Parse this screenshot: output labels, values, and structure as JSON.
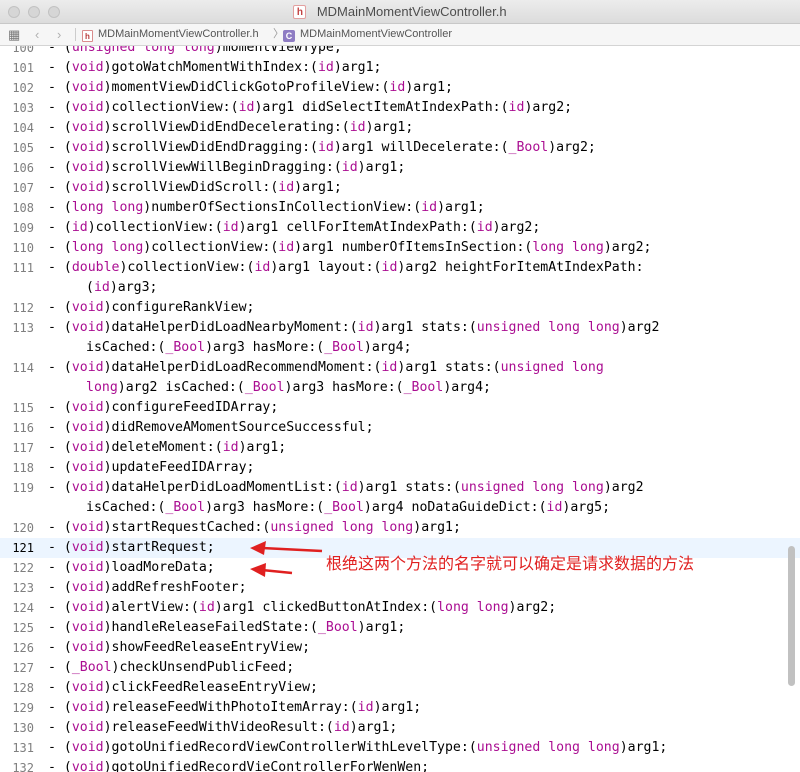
{
  "window": {
    "title": "MDMainMomentViewController.h",
    "title_icon_letter": "h"
  },
  "jumpbar": {
    "grid_icon": "grid-icon",
    "back_glyph": "‹",
    "forward_glyph": "›",
    "crumb1_icon": "h",
    "crumb1": "MDMainMomentViewController.h",
    "crumb_sep": "〉",
    "crumb2_icon": "C",
    "crumb2": "MDMainMomentViewController"
  },
  "colors": {
    "keyword": "#aa0d91",
    "annotation": "#e02020",
    "current_line": "#ecf5ff"
  },
  "current_line": "121",
  "code_lines": [
    {
      "n": "100",
      "segs": [
        [
          "- (",
          ""
        ],
        [
          "unsigned long long",
          "kw"
        ],
        [
          ")momentViewType;",
          ""
        ]
      ]
    },
    {
      "n": "101",
      "segs": [
        [
          "- (",
          ""
        ],
        [
          "void",
          "kw"
        ],
        [
          ")gotoWatchMomentWithIndex:(",
          ""
        ],
        [
          "id",
          "kw"
        ],
        [
          ")arg1;",
          ""
        ]
      ]
    },
    {
      "n": "102",
      "segs": [
        [
          "- (",
          ""
        ],
        [
          "void",
          "kw"
        ],
        [
          ")momentViewDidClickGotoProfileView:(",
          ""
        ],
        [
          "id",
          "kw"
        ],
        [
          ")arg1;",
          ""
        ]
      ]
    },
    {
      "n": "103",
      "segs": [
        [
          "- (",
          ""
        ],
        [
          "void",
          "kw"
        ],
        [
          ")collectionView:(",
          ""
        ],
        [
          "id",
          "kw"
        ],
        [
          ")arg1 didSelectItemAtIndexPath:(",
          ""
        ],
        [
          "id",
          "kw"
        ],
        [
          ")arg2;",
          ""
        ]
      ]
    },
    {
      "n": "104",
      "segs": [
        [
          "- (",
          ""
        ],
        [
          "void",
          "kw"
        ],
        [
          ")scrollViewDidEndDecelerating:(",
          ""
        ],
        [
          "id",
          "kw"
        ],
        [
          ")arg1;",
          ""
        ]
      ]
    },
    {
      "n": "105",
      "segs": [
        [
          "- (",
          ""
        ],
        [
          "void",
          "kw"
        ],
        [
          ")scrollViewDidEndDragging:(",
          ""
        ],
        [
          "id",
          "kw"
        ],
        [
          ")arg1 willDecelerate:(",
          ""
        ],
        [
          "_Bool",
          "kw"
        ],
        [
          ")arg2;",
          ""
        ]
      ]
    },
    {
      "n": "106",
      "segs": [
        [
          "- (",
          ""
        ],
        [
          "void",
          "kw"
        ],
        [
          ")scrollViewWillBeginDragging:(",
          ""
        ],
        [
          "id",
          "kw"
        ],
        [
          ")arg1;",
          ""
        ]
      ]
    },
    {
      "n": "107",
      "segs": [
        [
          "- (",
          ""
        ],
        [
          "void",
          "kw"
        ],
        [
          ")scrollViewDidScroll:(",
          ""
        ],
        [
          "id",
          "kw"
        ],
        [
          ")arg1;",
          ""
        ]
      ]
    },
    {
      "n": "108",
      "segs": [
        [
          "- (",
          ""
        ],
        [
          "long long",
          "kw"
        ],
        [
          ")numberOfSectionsInCollectionView:(",
          ""
        ],
        [
          "id",
          "kw"
        ],
        [
          ")arg1;",
          ""
        ]
      ]
    },
    {
      "n": "109",
      "segs": [
        [
          "- (",
          ""
        ],
        [
          "id",
          "kw"
        ],
        [
          ")collectionView:(",
          ""
        ],
        [
          "id",
          "kw"
        ],
        [
          ")arg1 cellForItemAtIndexPath:(",
          ""
        ],
        [
          "id",
          "kw"
        ],
        [
          ")arg2;",
          ""
        ]
      ]
    },
    {
      "n": "110",
      "segs": [
        [
          "- (",
          ""
        ],
        [
          "long long",
          "kw"
        ],
        [
          ")collectionView:(",
          ""
        ],
        [
          "id",
          "kw"
        ],
        [
          ")arg1 numberOfItemsInSection:(",
          ""
        ],
        [
          "long long",
          "kw"
        ],
        [
          ")arg2;",
          ""
        ]
      ]
    },
    {
      "n": "111",
      "segs": [
        [
          "- (",
          ""
        ],
        [
          "double",
          "kw"
        ],
        [
          ")collectionView:(",
          ""
        ],
        [
          "id",
          "kw"
        ],
        [
          ")arg1 layout:(",
          ""
        ],
        [
          "id",
          "kw"
        ],
        [
          ")arg2 heightForItemAtIndexPath:",
          ""
        ]
      ]
    },
    {
      "n": "",
      "cont": true,
      "segs": [
        [
          "(",
          ""
        ],
        [
          "id",
          "kw"
        ],
        [
          ")arg3;",
          ""
        ]
      ]
    },
    {
      "n": "112",
      "segs": [
        [
          "- (",
          ""
        ],
        [
          "void",
          "kw"
        ],
        [
          ")configureRankView;",
          ""
        ]
      ]
    },
    {
      "n": "113",
      "segs": [
        [
          "- (",
          ""
        ],
        [
          "void",
          "kw"
        ],
        [
          ")dataHelperDidLoadNearbyMoment:(",
          ""
        ],
        [
          "id",
          "kw"
        ],
        [
          ")arg1 stats:(",
          ""
        ],
        [
          "unsigned long long",
          "kw"
        ],
        [
          ")arg2",
          ""
        ]
      ]
    },
    {
      "n": "",
      "cont": true,
      "segs": [
        [
          "isCached:(",
          ""
        ],
        [
          "_Bool",
          "kw"
        ],
        [
          ")arg3 hasMore:(",
          ""
        ],
        [
          "_Bool",
          "kw"
        ],
        [
          ")arg4;",
          ""
        ]
      ]
    },
    {
      "n": "114",
      "segs": [
        [
          "- (",
          ""
        ],
        [
          "void",
          "kw"
        ],
        [
          ")dataHelperDidLoadRecommendMoment:(",
          ""
        ],
        [
          "id",
          "kw"
        ],
        [
          ")arg1 stats:(",
          ""
        ],
        [
          "unsigned long",
          "kw"
        ]
      ]
    },
    {
      "n": "",
      "cont": true,
      "segs": [
        [
          "long",
          "kw"
        ],
        [
          ")arg2 isCached:(",
          ""
        ],
        [
          "_Bool",
          "kw"
        ],
        [
          ")arg3 hasMore:(",
          ""
        ],
        [
          "_Bool",
          "kw"
        ],
        [
          ")arg4;",
          ""
        ]
      ]
    },
    {
      "n": "115",
      "segs": [
        [
          "- (",
          ""
        ],
        [
          "void",
          "kw"
        ],
        [
          ")configureFeedIDArray;",
          ""
        ]
      ]
    },
    {
      "n": "116",
      "segs": [
        [
          "- (",
          ""
        ],
        [
          "void",
          "kw"
        ],
        [
          ")didRemoveAMomentSourceSuccessful;",
          ""
        ]
      ]
    },
    {
      "n": "117",
      "segs": [
        [
          "- (",
          ""
        ],
        [
          "void",
          "kw"
        ],
        [
          ")deleteMoment:(",
          ""
        ],
        [
          "id",
          "kw"
        ],
        [
          ")arg1;",
          ""
        ]
      ]
    },
    {
      "n": "118",
      "segs": [
        [
          "- (",
          ""
        ],
        [
          "void",
          "kw"
        ],
        [
          ")updateFeedIDArray;",
          ""
        ]
      ]
    },
    {
      "n": "119",
      "segs": [
        [
          "- (",
          ""
        ],
        [
          "void",
          "kw"
        ],
        [
          ")dataHelperDidLoadMomentList:(",
          ""
        ],
        [
          "id",
          "kw"
        ],
        [
          ")arg1 stats:(",
          ""
        ],
        [
          "unsigned long long",
          "kw"
        ],
        [
          ")arg2",
          ""
        ]
      ]
    },
    {
      "n": "",
      "cont": true,
      "segs": [
        [
          "isCached:(",
          ""
        ],
        [
          "_Bool",
          "kw"
        ],
        [
          ")arg3 hasMore:(",
          ""
        ],
        [
          "_Bool",
          "kw"
        ],
        [
          ")arg4 noDataGuideDict:(",
          ""
        ],
        [
          "id",
          "kw"
        ],
        [
          ")arg5;",
          ""
        ]
      ]
    },
    {
      "n": "120",
      "segs": [
        [
          "- (",
          ""
        ],
        [
          "void",
          "kw"
        ],
        [
          ")startRequestCached:(",
          ""
        ],
        [
          "unsigned long long",
          "kw"
        ],
        [
          ")arg1;",
          ""
        ]
      ]
    },
    {
      "n": "121",
      "segs": [
        [
          "- (",
          ""
        ],
        [
          "void",
          "kw"
        ],
        [
          ")startRequest;",
          ""
        ]
      ]
    },
    {
      "n": "122",
      "segs": [
        [
          "- (",
          ""
        ],
        [
          "void",
          "kw"
        ],
        [
          ")loadMoreData;",
          ""
        ]
      ]
    },
    {
      "n": "123",
      "segs": [
        [
          "- (",
          ""
        ],
        [
          "void",
          "kw"
        ],
        [
          ")addRefreshFooter;",
          ""
        ]
      ]
    },
    {
      "n": "124",
      "segs": [
        [
          "- (",
          ""
        ],
        [
          "void",
          "kw"
        ],
        [
          ")alertView:(",
          ""
        ],
        [
          "id",
          "kw"
        ],
        [
          ")arg1 clickedButtonAtIndex:(",
          ""
        ],
        [
          "long long",
          "kw"
        ],
        [
          ")arg2;",
          ""
        ]
      ]
    },
    {
      "n": "125",
      "segs": [
        [
          "- (",
          ""
        ],
        [
          "void",
          "kw"
        ],
        [
          ")handleReleaseFailedState:(",
          ""
        ],
        [
          "_Bool",
          "kw"
        ],
        [
          ")arg1;",
          ""
        ]
      ]
    },
    {
      "n": "126",
      "segs": [
        [
          "- (",
          ""
        ],
        [
          "void",
          "kw"
        ],
        [
          ")showFeedReleaseEntryView;",
          ""
        ]
      ]
    },
    {
      "n": "127",
      "segs": [
        [
          "- (",
          ""
        ],
        [
          "_Bool",
          "kw"
        ],
        [
          ")checkUnsendPublicFeed;",
          ""
        ]
      ]
    },
    {
      "n": "128",
      "segs": [
        [
          "- (",
          ""
        ],
        [
          "void",
          "kw"
        ],
        [
          ")clickFeedReleaseEntryView;",
          ""
        ]
      ]
    },
    {
      "n": "129",
      "segs": [
        [
          "- (",
          ""
        ],
        [
          "void",
          "kw"
        ],
        [
          ")releaseFeedWithPhotoItemArray:(",
          ""
        ],
        [
          "id",
          "kw"
        ],
        [
          ")arg1;",
          ""
        ]
      ]
    },
    {
      "n": "130",
      "segs": [
        [
          "- (",
          ""
        ],
        [
          "void",
          "kw"
        ],
        [
          ")releaseFeedWithVideoResult:(",
          ""
        ],
        [
          "id",
          "kw"
        ],
        [
          ")arg1;",
          ""
        ]
      ]
    },
    {
      "n": "131",
      "segs": [
        [
          "- (",
          ""
        ],
        [
          "void",
          "kw"
        ],
        [
          ")gotoUnifiedRecordViewControllerWithLevelType:(",
          ""
        ],
        [
          "unsigned long long",
          "kw"
        ],
        [
          ")arg1;",
          ""
        ]
      ]
    },
    {
      "n": "132",
      "segs": [
        [
          "- (",
          ""
        ],
        [
          "void",
          "kw"
        ],
        [
          ")gotoUnifiedRecordVieControllerForWenWen;",
          ""
        ]
      ]
    }
  ],
  "annotation": {
    "text": "根绝这两个方法的名字就可以确定是请求数据的方法",
    "color": "#e02020"
  }
}
